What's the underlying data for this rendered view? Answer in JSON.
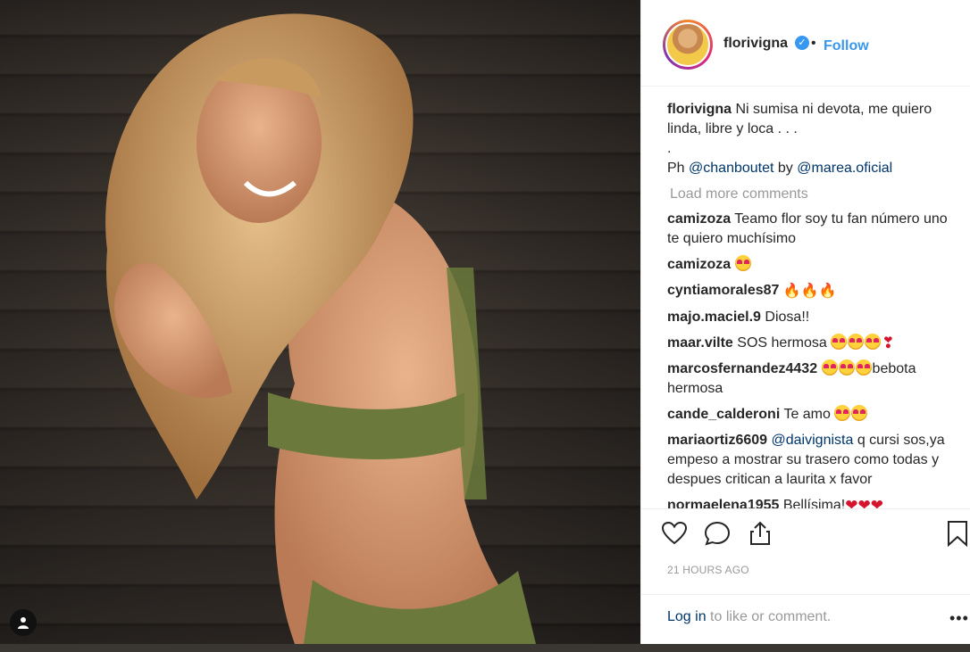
{
  "post": {
    "username": "florivigna",
    "verified_glyph": "✓",
    "dot": "•",
    "follow_label": "Follow",
    "caption": {
      "username": "florivigna",
      "text": "Ni sumisa ni devota, me quiero linda, libre y loca . . .",
      "dot_line": ".",
      "ph_prefix": "Ph",
      "ph_mention": "@chanboutet",
      "by": "by",
      "by_mention": "@marea.oficial"
    },
    "load_more": "Load more comments",
    "comments": [
      {
        "user": "camizoza",
        "text": "Teamo flor soy tu fan número uno te quiero muchísimo"
      },
      {
        "user": "camizoza",
        "emoji": "heart-eyes"
      },
      {
        "user": "cyntiamorales87",
        "emoji": "fire x3"
      },
      {
        "user": "majo.maciel.9",
        "text": "Diosa!!"
      },
      {
        "user": "maar.vilte",
        "text": "SOS hermosa",
        "emoji": "heart-eyes x3, heart"
      },
      {
        "user": "marcosfernandez4432",
        "text": "bebota hermosa",
        "emoji": "heart-eyes x3"
      },
      {
        "user": "cande_calderoni",
        "text": "Te amo",
        "emoji": "heart-eyes x2"
      },
      {
        "user": "mariaortiz6609",
        "mention": "@daivignista",
        "text": "q cursi sos,ya empeso a mostrar su trasero como todas y despues critican a laurita x favor"
      },
      {
        "user": "normaelena1955",
        "text": "Bellísima!",
        "emoji": "heart x3"
      }
    ],
    "timestamp": "21 HOURS AGO",
    "login": {
      "link": "Log in",
      "rest": "to like or comment."
    },
    "more_glyph": "•••",
    "icons": [
      "heart-icon",
      "comment-icon",
      "share-icon",
      "bookmark-icon",
      "user-tag-icon"
    ]
  }
}
